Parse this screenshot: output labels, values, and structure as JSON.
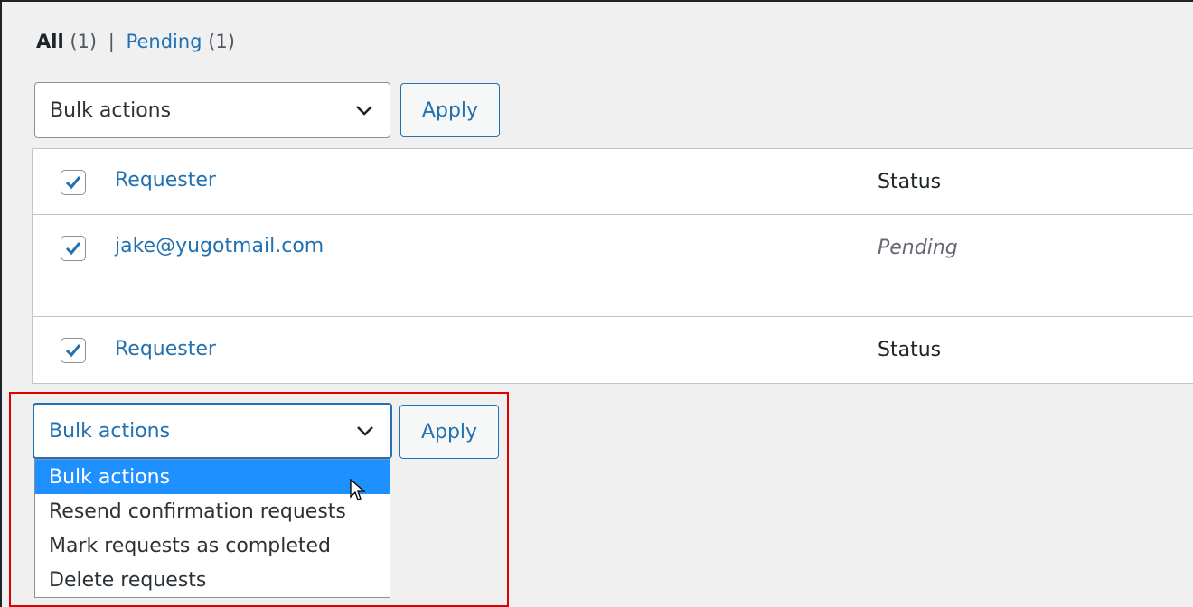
{
  "filters": {
    "all_label": "All",
    "all_count": "(1)",
    "separator": "|",
    "pending_label": "Pending",
    "pending_count": "(1)"
  },
  "top_actions": {
    "select_value": "Bulk actions",
    "apply_label": "Apply"
  },
  "table": {
    "header": {
      "col_requester": "Requester",
      "col_status": "Status",
      "checked": true
    },
    "rows": [
      {
        "requester": "jake@yugotmail.com",
        "status": "Pending",
        "checked": true
      }
    ],
    "footer": {
      "col_requester": "Requester",
      "col_status": "Status",
      "checked": true
    }
  },
  "bottom_actions": {
    "select_value": "Bulk actions",
    "apply_label": "Apply",
    "options": [
      "Bulk actions",
      "Resend confirmation requests",
      "Mark requests as completed",
      "Delete requests"
    ],
    "selected_index": 0
  },
  "colors": {
    "link": "#2271b1",
    "highlight_border": "#e00000",
    "selected_option_bg": "#1e90ff",
    "background": "#f0f0f1"
  },
  "icons": {
    "select_chevron": "chevron-down-icon",
    "checkbox_mark": "checkmark-icon",
    "pointer": "mouse-pointer-icon"
  }
}
